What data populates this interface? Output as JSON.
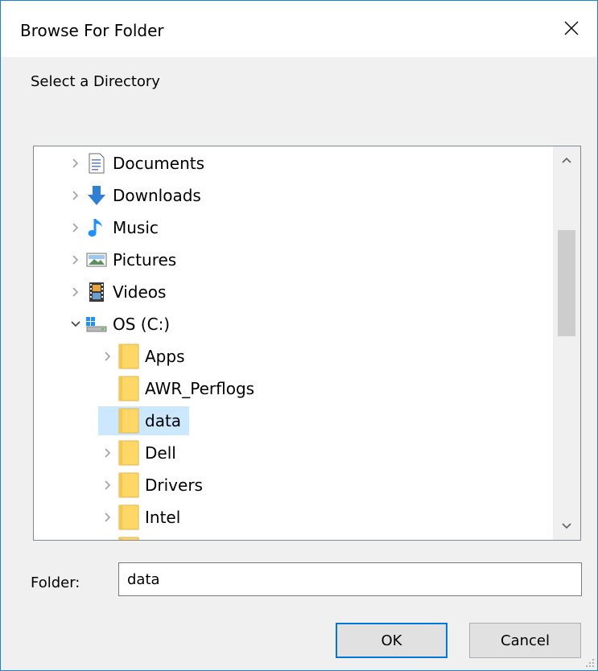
{
  "dialog": {
    "title": "Browse For Folder",
    "prompt": "Select a Directory",
    "folder_label": "Folder:",
    "folder_value": "data",
    "ok_label": "OK",
    "cancel_label": "Cancel"
  },
  "tree": {
    "items": [
      {
        "label": "Documents",
        "icon": "documents-icon",
        "state": "collapsed",
        "level": 0
      },
      {
        "label": "Downloads",
        "icon": "downloads-icon",
        "state": "collapsed",
        "level": 0
      },
      {
        "label": "Music",
        "icon": "music-icon",
        "state": "collapsed",
        "level": 0
      },
      {
        "label": "Pictures",
        "icon": "pictures-icon",
        "state": "collapsed",
        "level": 0
      },
      {
        "label": "Videos",
        "icon": "videos-icon",
        "state": "collapsed",
        "level": 0
      },
      {
        "label": "OS (C:)",
        "icon": "drive-icon",
        "state": "expanded",
        "level": 0
      },
      {
        "label": "Apps",
        "icon": "folder-icon",
        "state": "collapsed",
        "level": 1
      },
      {
        "label": "AWR_Perflogs",
        "icon": "folder-icon",
        "state": "none",
        "level": 1
      },
      {
        "label": "data",
        "icon": "folder-icon",
        "state": "none",
        "level": 1,
        "selected": true
      },
      {
        "label": "Dell",
        "icon": "folder-icon",
        "state": "collapsed",
        "level": 1
      },
      {
        "label": "Drivers",
        "icon": "folder-icon",
        "state": "collapsed",
        "level": 1
      },
      {
        "label": "Intel",
        "icon": "folder-icon",
        "state": "collapsed",
        "level": 1
      }
    ]
  },
  "colors": {
    "selection": "#cce8ff",
    "window_border": "#1883d7",
    "default_button_border": "#0078d7",
    "folder": "#ffd766",
    "downloads": "#2f7fd6",
    "music": "#1e90ff"
  }
}
